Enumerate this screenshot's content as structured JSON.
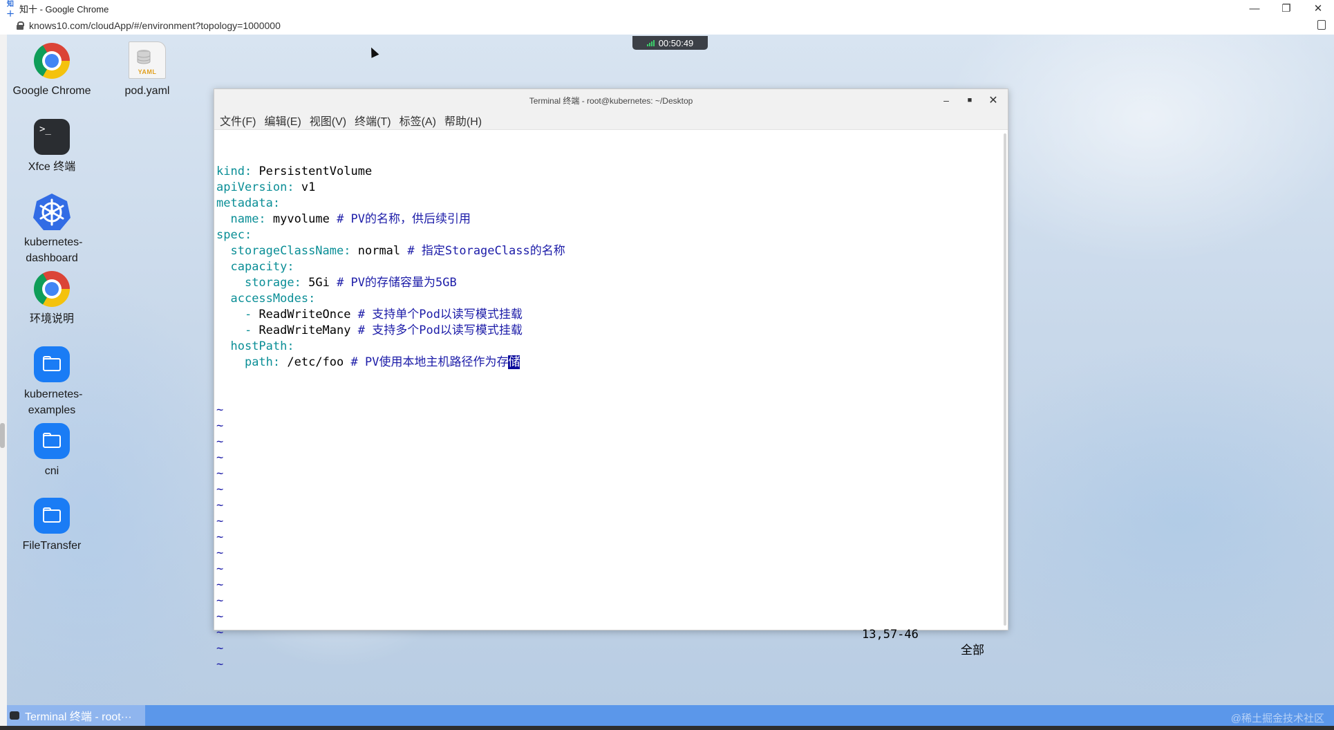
{
  "browser": {
    "title": "知十 - Google Chrome",
    "favicon_text": "知十",
    "url": "knows10.com/cloudApp/#/environment?topology=1000000"
  },
  "session": {
    "timer": "00:50:49"
  },
  "desktop_icons": [
    {
      "label": "Google Chrome",
      "icon": "chrome-icon"
    },
    {
      "label": "pod.yaml",
      "icon": "yaml-file-icon",
      "badge": "YAML"
    },
    {
      "label": "Xfce 终端",
      "icon": "terminal-icon",
      "glyph": ">_"
    },
    {
      "label": "kubernetes-dashboard",
      "icon": "kubernetes-icon"
    },
    {
      "label": "环境说明",
      "icon": "chrome-icon"
    },
    {
      "label": "kubernetes-examples",
      "icon": "folder-icon"
    },
    {
      "label": "cni",
      "icon": "folder-icon"
    },
    {
      "label": "FileTransfer",
      "icon": "folder-icon"
    }
  ],
  "terminal": {
    "title": "Terminal 终端 - root@kubernetes: ~/Desktop",
    "menu": [
      "文件(F)",
      "编辑(E)",
      "视图(V)",
      "终端(T)",
      "标签(A)",
      "帮助(H)"
    ],
    "lines": [
      {
        "indent": "",
        "key": "kind",
        "value": "PersistentVolume",
        "comment": ""
      },
      {
        "indent": "",
        "key": "apiVersion",
        "value": "v1",
        "comment": ""
      },
      {
        "indent": "",
        "key": "metadata",
        "value": "",
        "comment": ""
      },
      {
        "indent": "  ",
        "key": "name",
        "value": "myvolume",
        "comment": "# PV的名称，供后续引用"
      },
      {
        "indent": "",
        "key": "spec",
        "value": "",
        "comment": ""
      },
      {
        "indent": "  ",
        "key": "storageClassName",
        "value": "normal",
        "comment": "# 指定StorageClass的名称"
      },
      {
        "indent": "  ",
        "key": "capacity",
        "value": "",
        "comment": ""
      },
      {
        "indent": "    ",
        "key": "storage",
        "value": "5Gi",
        "comment": "# PV的存储容量为5GB"
      },
      {
        "indent": "  ",
        "key": "accessModes",
        "value": "",
        "comment": ""
      },
      {
        "indent": "    ",
        "dash": "- ",
        "value": "ReadWriteOnce",
        "comment": "# 支持单个Pod以读写模式挂载"
      },
      {
        "indent": "    ",
        "dash": "- ",
        "value": "ReadWriteMany",
        "comment": "# 支持多个Pod以读写模式挂载"
      },
      {
        "indent": "  ",
        "key": "hostPath",
        "value": "",
        "comment": ""
      },
      {
        "indent": "    ",
        "key": "path",
        "value": "/etc/foo",
        "comment": "# PV使用本地主机路径作为存",
        "cursor_char": "储"
      }
    ],
    "tilde": "~",
    "tilde_count": 17,
    "status": {
      "position": "13,57-46",
      "scroll": "全部"
    }
  },
  "taskbar": {
    "item_label": "Terminal 终端 - root···"
  },
  "watermark": "@稀土掘金技术社区",
  "colors": {
    "yaml_key": "#0a8e96",
    "yaml_comment": "#1c1ca8",
    "cursor_bg": "#0a0a9c",
    "taskbar": "#5b97ea"
  }
}
